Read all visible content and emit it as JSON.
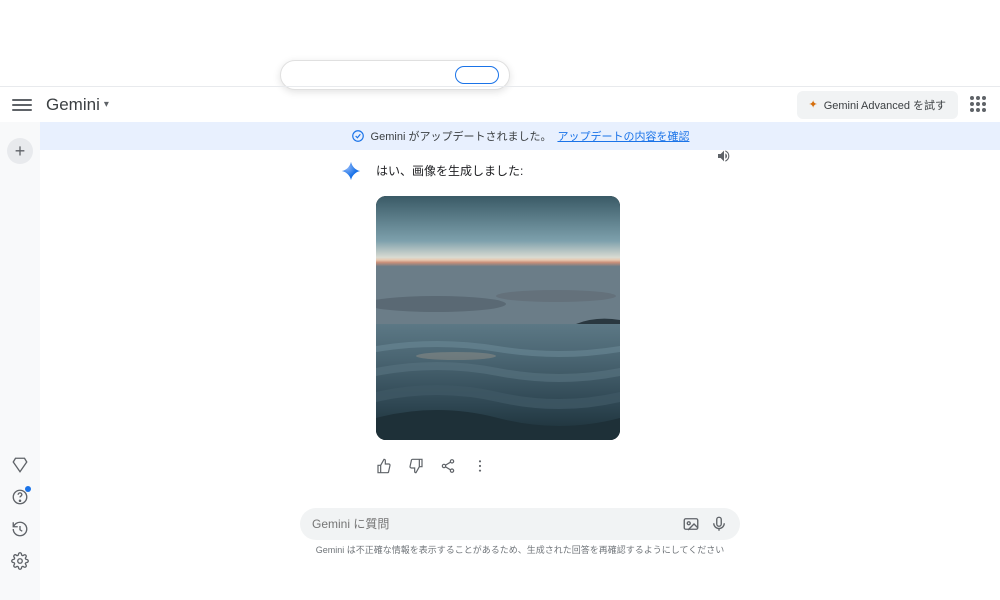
{
  "header": {
    "brand": "Gemini",
    "advanced_button": "Gemini Advanced を試す"
  },
  "banner": {
    "text": "Gemini がアップデートされました。",
    "link": "アップデートの内容を確認"
  },
  "rail": {
    "plus": "+"
  },
  "message": {
    "text": "はい、画像を生成しました:"
  },
  "input": {
    "placeholder": "Gemini に質問"
  },
  "disclaimer": "Gemini は不正確な情報を表示することがあるため、生成された回答を再確認するようにしてください"
}
